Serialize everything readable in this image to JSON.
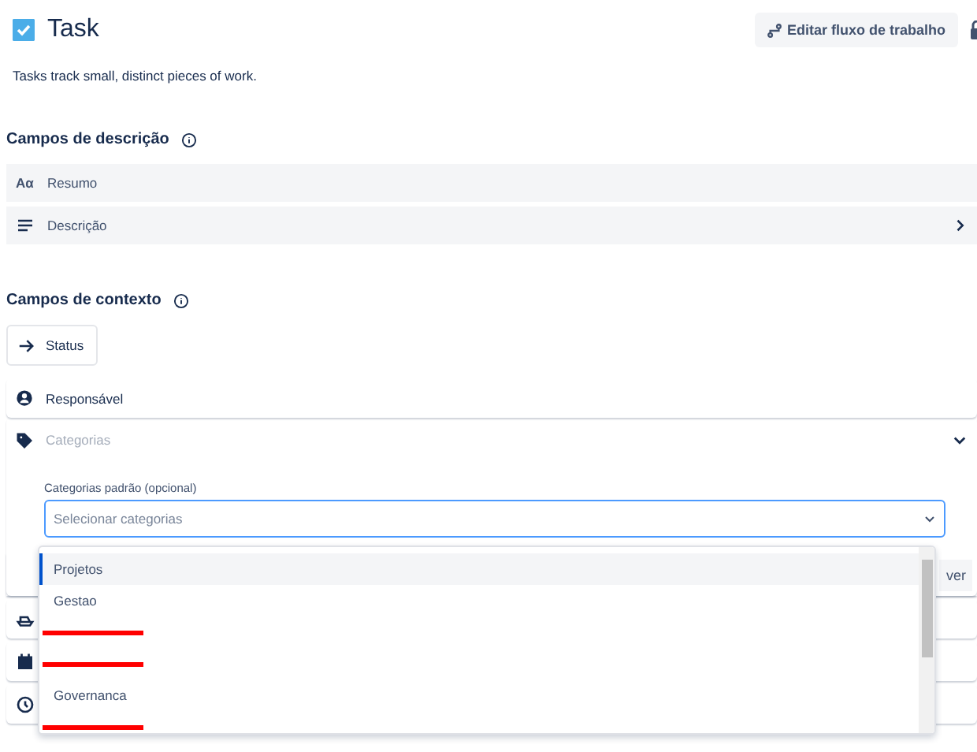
{
  "header": {
    "title": "Task",
    "checked": true,
    "button": "Editar fluxo de trabalho"
  },
  "description": "Tasks track small, distinct pieces of work.",
  "description_fields": {
    "heading": "Campos de descrição",
    "items": [
      {
        "kind": "text",
        "icon": "Aα",
        "label": "Resumo",
        "expandable": false
      },
      {
        "kind": "lines",
        "label": "Descrição",
        "expandable": true
      }
    ]
  },
  "context_fields": {
    "heading": "Campos de contexto",
    "status": "Status",
    "assignee": "Responsável",
    "categories": {
      "label": "Categorias",
      "expanded": true,
      "field_label": "Categorias padrão (opcional)",
      "placeholder": "Selecionar categorias",
      "behind_button": "ver"
    },
    "hidden_rows": [
      {
        "kind": "ship"
      },
      {
        "kind": "calendar"
      },
      {
        "kind": "clock"
      }
    ]
  },
  "dropdown": {
    "options": [
      {
        "label": "Projetos",
        "selected": true,
        "redacted": false
      },
      {
        "label": "Gestao",
        "selected": false,
        "redacted": false
      },
      {
        "selected": false,
        "redacted": true
      },
      {
        "selected": false,
        "redacted": true
      },
      {
        "label": "Governanca",
        "selected": false,
        "redacted": false
      },
      {
        "selected": false,
        "redacted": true
      }
    ]
  }
}
